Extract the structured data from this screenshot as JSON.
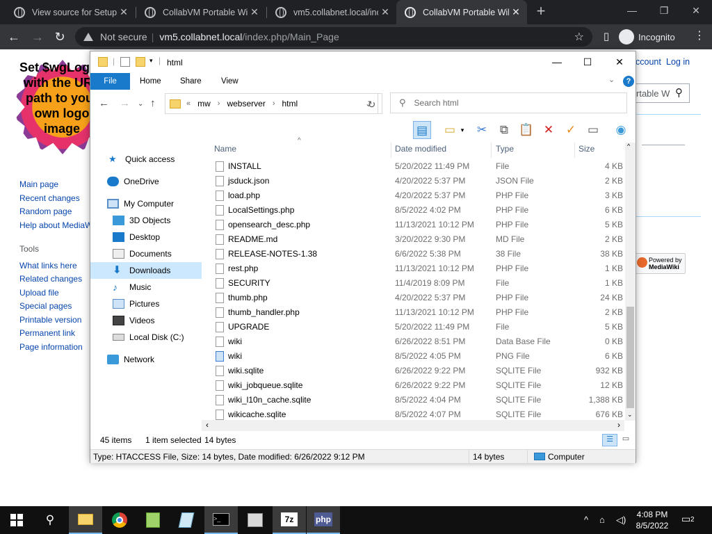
{
  "browser": {
    "tabs": [
      {
        "title": "View source for Setup I",
        "active": false
      },
      {
        "title": "CollabVM Portable Wik",
        "active": false
      },
      {
        "title": "vm5.collabnet.local/inc",
        "active": false
      },
      {
        "title": "CollabVM Portable Wik",
        "active": true
      }
    ],
    "new_tab": "+",
    "security_label": "Not secure",
    "url_host": "vm5.collabnet.local",
    "url_path": "/index.php/Main_Page",
    "profile_label": "Incognito"
  },
  "wiki": {
    "logo_text": "Set $wgLogos with the URL path to your own logo image",
    "account": "ccount",
    "login": "Log in",
    "search_value": "rtable W",
    "nav_links": [
      "Main page",
      "Recent changes",
      "Random page",
      "Help about MediaW"
    ],
    "tools_heading": "Tools",
    "tools_links": [
      "What links here",
      "Related changes",
      "Upload file",
      "Special pages",
      "Printable version",
      "Permanent link",
      "Page information"
    ],
    "powered_line1": "Powered by",
    "powered_line2": "MediaWiki"
  },
  "explorer": {
    "title": "html",
    "ribbon_tabs": [
      "File",
      "Home",
      "Share",
      "View"
    ],
    "help": "?",
    "breadcrumb": [
      "mw",
      "webserver",
      "html"
    ],
    "breadcrumb_prefix": "«",
    "search_placeholder": "Search html",
    "nav_items": [
      {
        "label": "Quick access",
        "icon": "star-icon"
      },
      {
        "label": "OneDrive",
        "icon": "cloud-icon"
      },
      {
        "label": "My Computer",
        "icon": "computer-icon"
      },
      {
        "label": "3D Objects",
        "icon": "cube-icon"
      },
      {
        "label": "Desktop",
        "icon": "desktop-icon"
      },
      {
        "label": "Documents",
        "icon": "documents-icon"
      },
      {
        "label": "Downloads",
        "icon": "download-icon",
        "selected": true
      },
      {
        "label": "Music",
        "icon": "music-icon"
      },
      {
        "label": "Pictures",
        "icon": "pictures-icon"
      },
      {
        "label": "Videos",
        "icon": "videos-icon"
      },
      {
        "label": "Local Disk (C:)",
        "icon": "disk-icon"
      },
      {
        "label": "Network",
        "icon": "network-icon"
      }
    ],
    "columns": [
      "Name",
      "Date modified",
      "Type",
      "Size"
    ],
    "files": [
      {
        "name": "INSTALL",
        "date": "5/20/2022 11:49 PM",
        "type": "File",
        "size": "4 KB"
      },
      {
        "name": "jsduck.json",
        "date": "4/20/2022 5:37 PM",
        "type": "JSON File",
        "size": "2 KB"
      },
      {
        "name": "load.php",
        "date": "4/20/2022 5:37 PM",
        "type": "PHP File",
        "size": "3 KB"
      },
      {
        "name": "LocalSettings.php",
        "date": "8/5/2022 4:02 PM",
        "type": "PHP File",
        "size": "6 KB"
      },
      {
        "name": "opensearch_desc.php",
        "date": "11/13/2021 10:12 PM",
        "type": "PHP File",
        "size": "5 KB"
      },
      {
        "name": "README.md",
        "date": "3/20/2022 9:30 PM",
        "type": "MD File",
        "size": "2 KB"
      },
      {
        "name": "RELEASE-NOTES-1.38",
        "date": "6/6/2022 5:38 PM",
        "type": "38 File",
        "size": "38 KB"
      },
      {
        "name": "rest.php",
        "date": "11/13/2021 10:12 PM",
        "type": "PHP File",
        "size": "1 KB"
      },
      {
        "name": "SECURITY",
        "date": "11/4/2019 8:09 PM",
        "type": "File",
        "size": "1 KB"
      },
      {
        "name": "thumb.php",
        "date": "4/20/2022 5:37 PM",
        "type": "PHP File",
        "size": "24 KB"
      },
      {
        "name": "thumb_handler.php",
        "date": "11/13/2021 10:12 PM",
        "type": "PHP File",
        "size": "2 KB"
      },
      {
        "name": "UPGRADE",
        "date": "5/20/2022 11:49 PM",
        "type": "File",
        "size": "5 KB"
      },
      {
        "name": "wiki",
        "date": "6/26/2022 8:51 PM",
        "type": "Data Base File",
        "size": "0 KB"
      },
      {
        "name": "wiki",
        "date": "8/5/2022 4:05 PM",
        "type": "PNG File",
        "size": "6 KB"
      },
      {
        "name": "wiki.sqlite",
        "date": "6/26/2022 9:22 PM",
        "type": "SQLITE File",
        "size": "932 KB"
      },
      {
        "name": "wiki_jobqueue.sqlite",
        "date": "6/26/2022 9:22 PM",
        "type": "SQLITE File",
        "size": "12 KB"
      },
      {
        "name": "wiki_l10n_cache.sqlite",
        "date": "8/5/2022 4:04 PM",
        "type": "SQLITE File",
        "size": "1,388 KB"
      },
      {
        "name": "wikicache.sqlite",
        "date": "8/5/2022 4:07 PM",
        "type": "SQLITE File",
        "size": "676 KB"
      }
    ],
    "item_count": "45 items",
    "selection": "1 item selected",
    "selection_size": "14 bytes",
    "details": "Type: HTACCESS File, Size: 14 bytes, Date modified: 6/26/2022 9:12 PM",
    "details_size": "14 bytes",
    "details_location": "Computer"
  },
  "taskbar": {
    "time": "4:08 PM",
    "date": "8/5/2022",
    "notifications": "2",
    "apps": [
      "file-explorer-icon",
      "chrome-icon",
      "notepad-plus-icon",
      "paint-icon",
      "cmd-icon",
      "network-tool-icon",
      "7zip-icon",
      "php-icon"
    ]
  }
}
